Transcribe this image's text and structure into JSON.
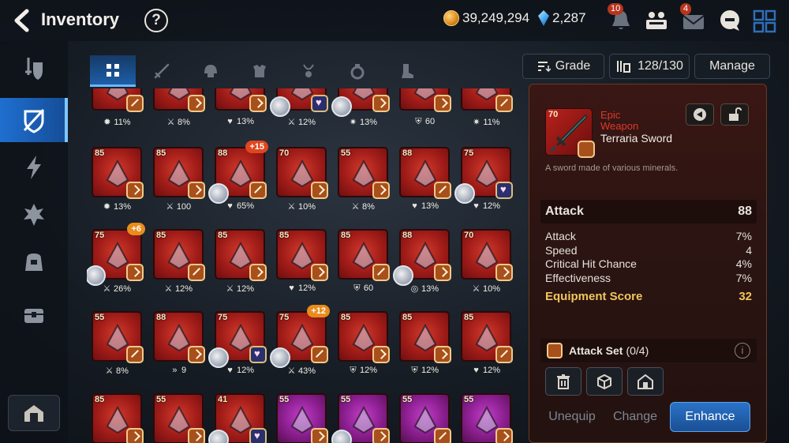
{
  "header": {
    "title": "Inventory",
    "help_label": "?",
    "gold": "39,249,294",
    "crystals": "2,287",
    "notification_count": "10",
    "mail_count": "4"
  },
  "tabs": [
    "all",
    "weapon",
    "helmet",
    "armor",
    "necklace",
    "ring",
    "boots"
  ],
  "grid": {
    "row0_stats": [
      {
        "icon": "crit-icon",
        "value": "11%"
      },
      {
        "icon": "attack-icon",
        "value": "8%"
      },
      {
        "icon": "health-icon",
        "value": "13%"
      },
      {
        "icon": "attack-icon",
        "value": "12%"
      },
      {
        "icon": "crit-damage-icon",
        "value": "13%"
      },
      {
        "icon": "defense-icon",
        "value": "60"
      },
      {
        "icon": "crit-damage-icon",
        "value": "11%"
      }
    ],
    "row1": [
      {
        "level": "85",
        "stat": "13%",
        "icon": "crit-icon"
      },
      {
        "level": "85",
        "stat": "100",
        "icon": "attack-icon"
      },
      {
        "level": "88",
        "enhance": "+15",
        "stat": "65%",
        "icon": "health-icon"
      },
      {
        "level": "70",
        "stat": "10%",
        "icon": "attack-icon"
      },
      {
        "level": "55",
        "stat": "8%",
        "icon": "attack-icon"
      },
      {
        "level": "88",
        "stat": "13%",
        "icon": "health-icon"
      },
      {
        "level": "75",
        "stat": "12%",
        "icon": "health-icon"
      }
    ],
    "row2": [
      {
        "level": "75",
        "enhance": "+6",
        "stat": "26%",
        "icon": "attack-icon"
      },
      {
        "level": "85",
        "stat": "12%",
        "icon": "attack-icon"
      },
      {
        "level": "85",
        "stat": "12%",
        "icon": "attack-icon"
      },
      {
        "level": "85",
        "stat": "12%",
        "icon": "health-icon"
      },
      {
        "level": "85",
        "stat": "60",
        "icon": "defense-icon"
      },
      {
        "level": "88",
        "stat": "13%",
        "icon": "effect-resist-icon"
      },
      {
        "level": "70",
        "stat": "10%",
        "icon": "attack-icon"
      }
    ],
    "row3": [
      {
        "level": "55",
        "stat": "8%",
        "icon": "attack-icon"
      },
      {
        "level": "88",
        "stat": "9",
        "icon": "speed-icon"
      },
      {
        "level": "75",
        "stat": "12%",
        "icon": "health-icon"
      },
      {
        "level": "75",
        "enhance": "+12",
        "stat": "43%",
        "icon": "attack-icon"
      },
      {
        "level": "85",
        "stat": "12%",
        "icon": "defense-icon"
      },
      {
        "level": "85",
        "stat": "12%",
        "icon": "defense-icon"
      },
      {
        "level": "85",
        "stat": "12%",
        "icon": "health-icon"
      }
    ],
    "row4": [
      {
        "level": "85"
      },
      {
        "level": "55"
      },
      {
        "level": "41"
      },
      {
        "level": "55"
      },
      {
        "level": "55"
      },
      {
        "level": "55"
      },
      {
        "level": "55"
      }
    ]
  },
  "filters": {
    "grade_label": "Grade",
    "capacity": "128/130",
    "manage_label": "Manage"
  },
  "detail": {
    "level": "70",
    "grade": "Epic",
    "type": "Weapon",
    "name": "Terraria Sword",
    "description": "A sword made of various minerals.",
    "main_stat": {
      "label": "Attack",
      "value": "88"
    },
    "substats": [
      {
        "label": "Attack",
        "value": "7%"
      },
      {
        "label": "Speed",
        "value": "4"
      },
      {
        "label": "Critical Hit Chance",
        "value": "4%"
      },
      {
        "label": "Effectiveness",
        "value": "7%"
      }
    ],
    "score_label": "Equipment Score",
    "score_value": "32",
    "set_label": "Attack Set",
    "set_count": "(0/4)",
    "unequip_label": "Unequip",
    "change_label": "Change",
    "enhance_label": "Enhance"
  },
  "colors": {
    "accent_blue": "#1f6fd0",
    "epic_red": "#e0382c",
    "score_gold": "#f1c75a",
    "enhance_button": "#1e5fb0"
  }
}
